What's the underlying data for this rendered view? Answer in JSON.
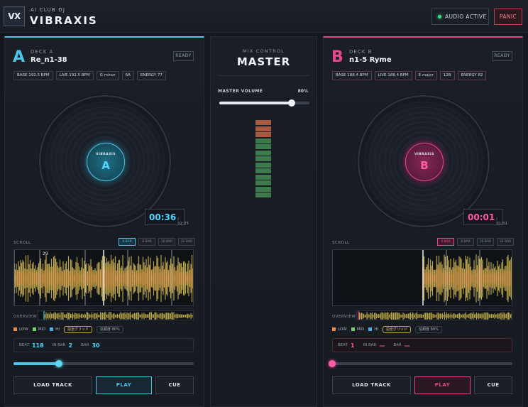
{
  "app": {
    "logo": "VX",
    "subtitle": "AI CLUB DJ",
    "title": "VIBRAXIS",
    "audio_status": "AUDIO ACTIVE",
    "panic_label": "PANIC"
  },
  "colors": {
    "deck_a": "#4fc6e8",
    "deck_b": "#e8458c",
    "audio_ok": "#3ce080",
    "panic": "#ff7d8c"
  },
  "deckA": {
    "letter": "A",
    "label": "DECK A",
    "track": "Re_n1-38",
    "status": "READY",
    "tags": [
      "BASE 192.5 BPM",
      "LIVE 192.5 BPM",
      "G minor",
      "6A",
      "ENERGY 77"
    ],
    "platter_brand": "VIBRAXIS",
    "platter_letter": "A",
    "time_current": "00:36",
    "time_total": "/ 02:25",
    "scroll_label": "SCROLL",
    "bar_options": [
      "4 BAR",
      "8 BAR",
      "16 BAR",
      "32 BAR"
    ],
    "bar_selected": 0,
    "bar_marker": "29",
    "overview_label": "OVERVIEW",
    "legend": {
      "low": "LOW",
      "mid": "MID",
      "hi": "HI",
      "grid": "拍全グリッド",
      "confidence": "信頼度 80%"
    },
    "beat": {
      "beat_label": "BEAT",
      "beat_value": "118",
      "inbar_label": "IN BAR",
      "inbar_value": "2",
      "bar_label": "BAR",
      "bar_value": "30"
    },
    "pitch": 0.25,
    "buttons": {
      "load": "LOAD TRACK",
      "play": "PLAY",
      "cue": "CUE"
    }
  },
  "deckB": {
    "letter": "B",
    "label": "DECK B",
    "track": "n1-5 Ryme",
    "status": "READY",
    "tags": [
      "BASE 188.4 BPM",
      "LIVE 188.4 BPM",
      "E major",
      "12B",
      "ENERGY 82"
    ],
    "platter_brand": "VIBRAXIS",
    "platter_letter": "B",
    "time_current": "00:01",
    "time_total": "/ 01:51",
    "scroll_label": "SCROLL",
    "bar_options": [
      "4 BAR",
      "8 BAR",
      "16 BAR",
      "32 BAR"
    ],
    "bar_selected": 0,
    "overview_label": "OVERVIEW",
    "legend": {
      "low": "LOW",
      "mid": "MID",
      "hi": "HI",
      "grid": "拍全グリッド",
      "confidence": "信頼度 80%"
    },
    "beat": {
      "beat_label": "BEAT",
      "beat_value": "1",
      "inbar_label": "IN BAR",
      "inbar_value": "—",
      "bar_label": "BAR",
      "bar_value": "—"
    },
    "pitch": 0.0,
    "buttons": {
      "load": "LOAD TRACK",
      "play": "PLAY",
      "cue": "CUE"
    }
  },
  "mixer": {
    "subtitle": "MIX CONTROL",
    "title": "MASTER",
    "volume_label": "MASTER VOLUME",
    "volume_text": "80%",
    "volume": 0.8,
    "meter_levels": {
      "total": 13,
      "red": 3
    }
  }
}
